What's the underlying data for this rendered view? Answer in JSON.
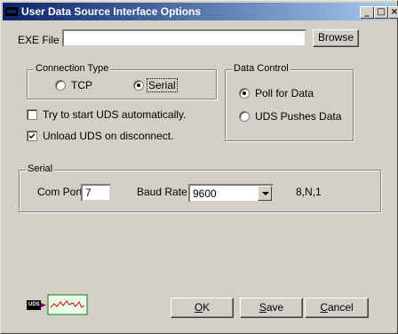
{
  "window": {
    "title": "User Data Source Interface Options",
    "minimize_glyph": "_",
    "maximize_glyph": "□",
    "close_glyph": "×"
  },
  "exe": {
    "label": "EXE File",
    "value": "",
    "browse_label": "Browse"
  },
  "connection_type": {
    "legend": "Connection Type",
    "options": [
      {
        "label": "TCP",
        "selected": false
      },
      {
        "label": "Serial",
        "selected": true
      }
    ]
  },
  "data_control": {
    "legend": "Data Control",
    "options": [
      {
        "label": "Poll for Data",
        "selected": true
      },
      {
        "label": "UDS Pushes Data",
        "selected": false
      }
    ]
  },
  "checkboxes": [
    {
      "label": "Try to start UDS automatically.",
      "checked": false
    },
    {
      "label": "Unload UDS on disconnect.",
      "checked": true
    }
  ],
  "serial": {
    "legend": "Serial",
    "com_port_label": "Com Port",
    "com_port_value": "7",
    "baud_rate_label": "Baud Rate",
    "baud_rate_value": "9600",
    "format_text": "8,N,1"
  },
  "logo": {
    "text": "UDS",
    "icon": "uds-graph-icon"
  },
  "buttons": {
    "ok_mnemonic": "O",
    "ok_rest": "K",
    "save_mnemonic": "S",
    "save_rest": "ave",
    "cancel_mnemonic": "C",
    "cancel_rest": "ancel"
  },
  "colors": {
    "titlebar_start": "#0a246a",
    "titlebar_end": "#a6caf0",
    "face": "#d4d0c8"
  }
}
